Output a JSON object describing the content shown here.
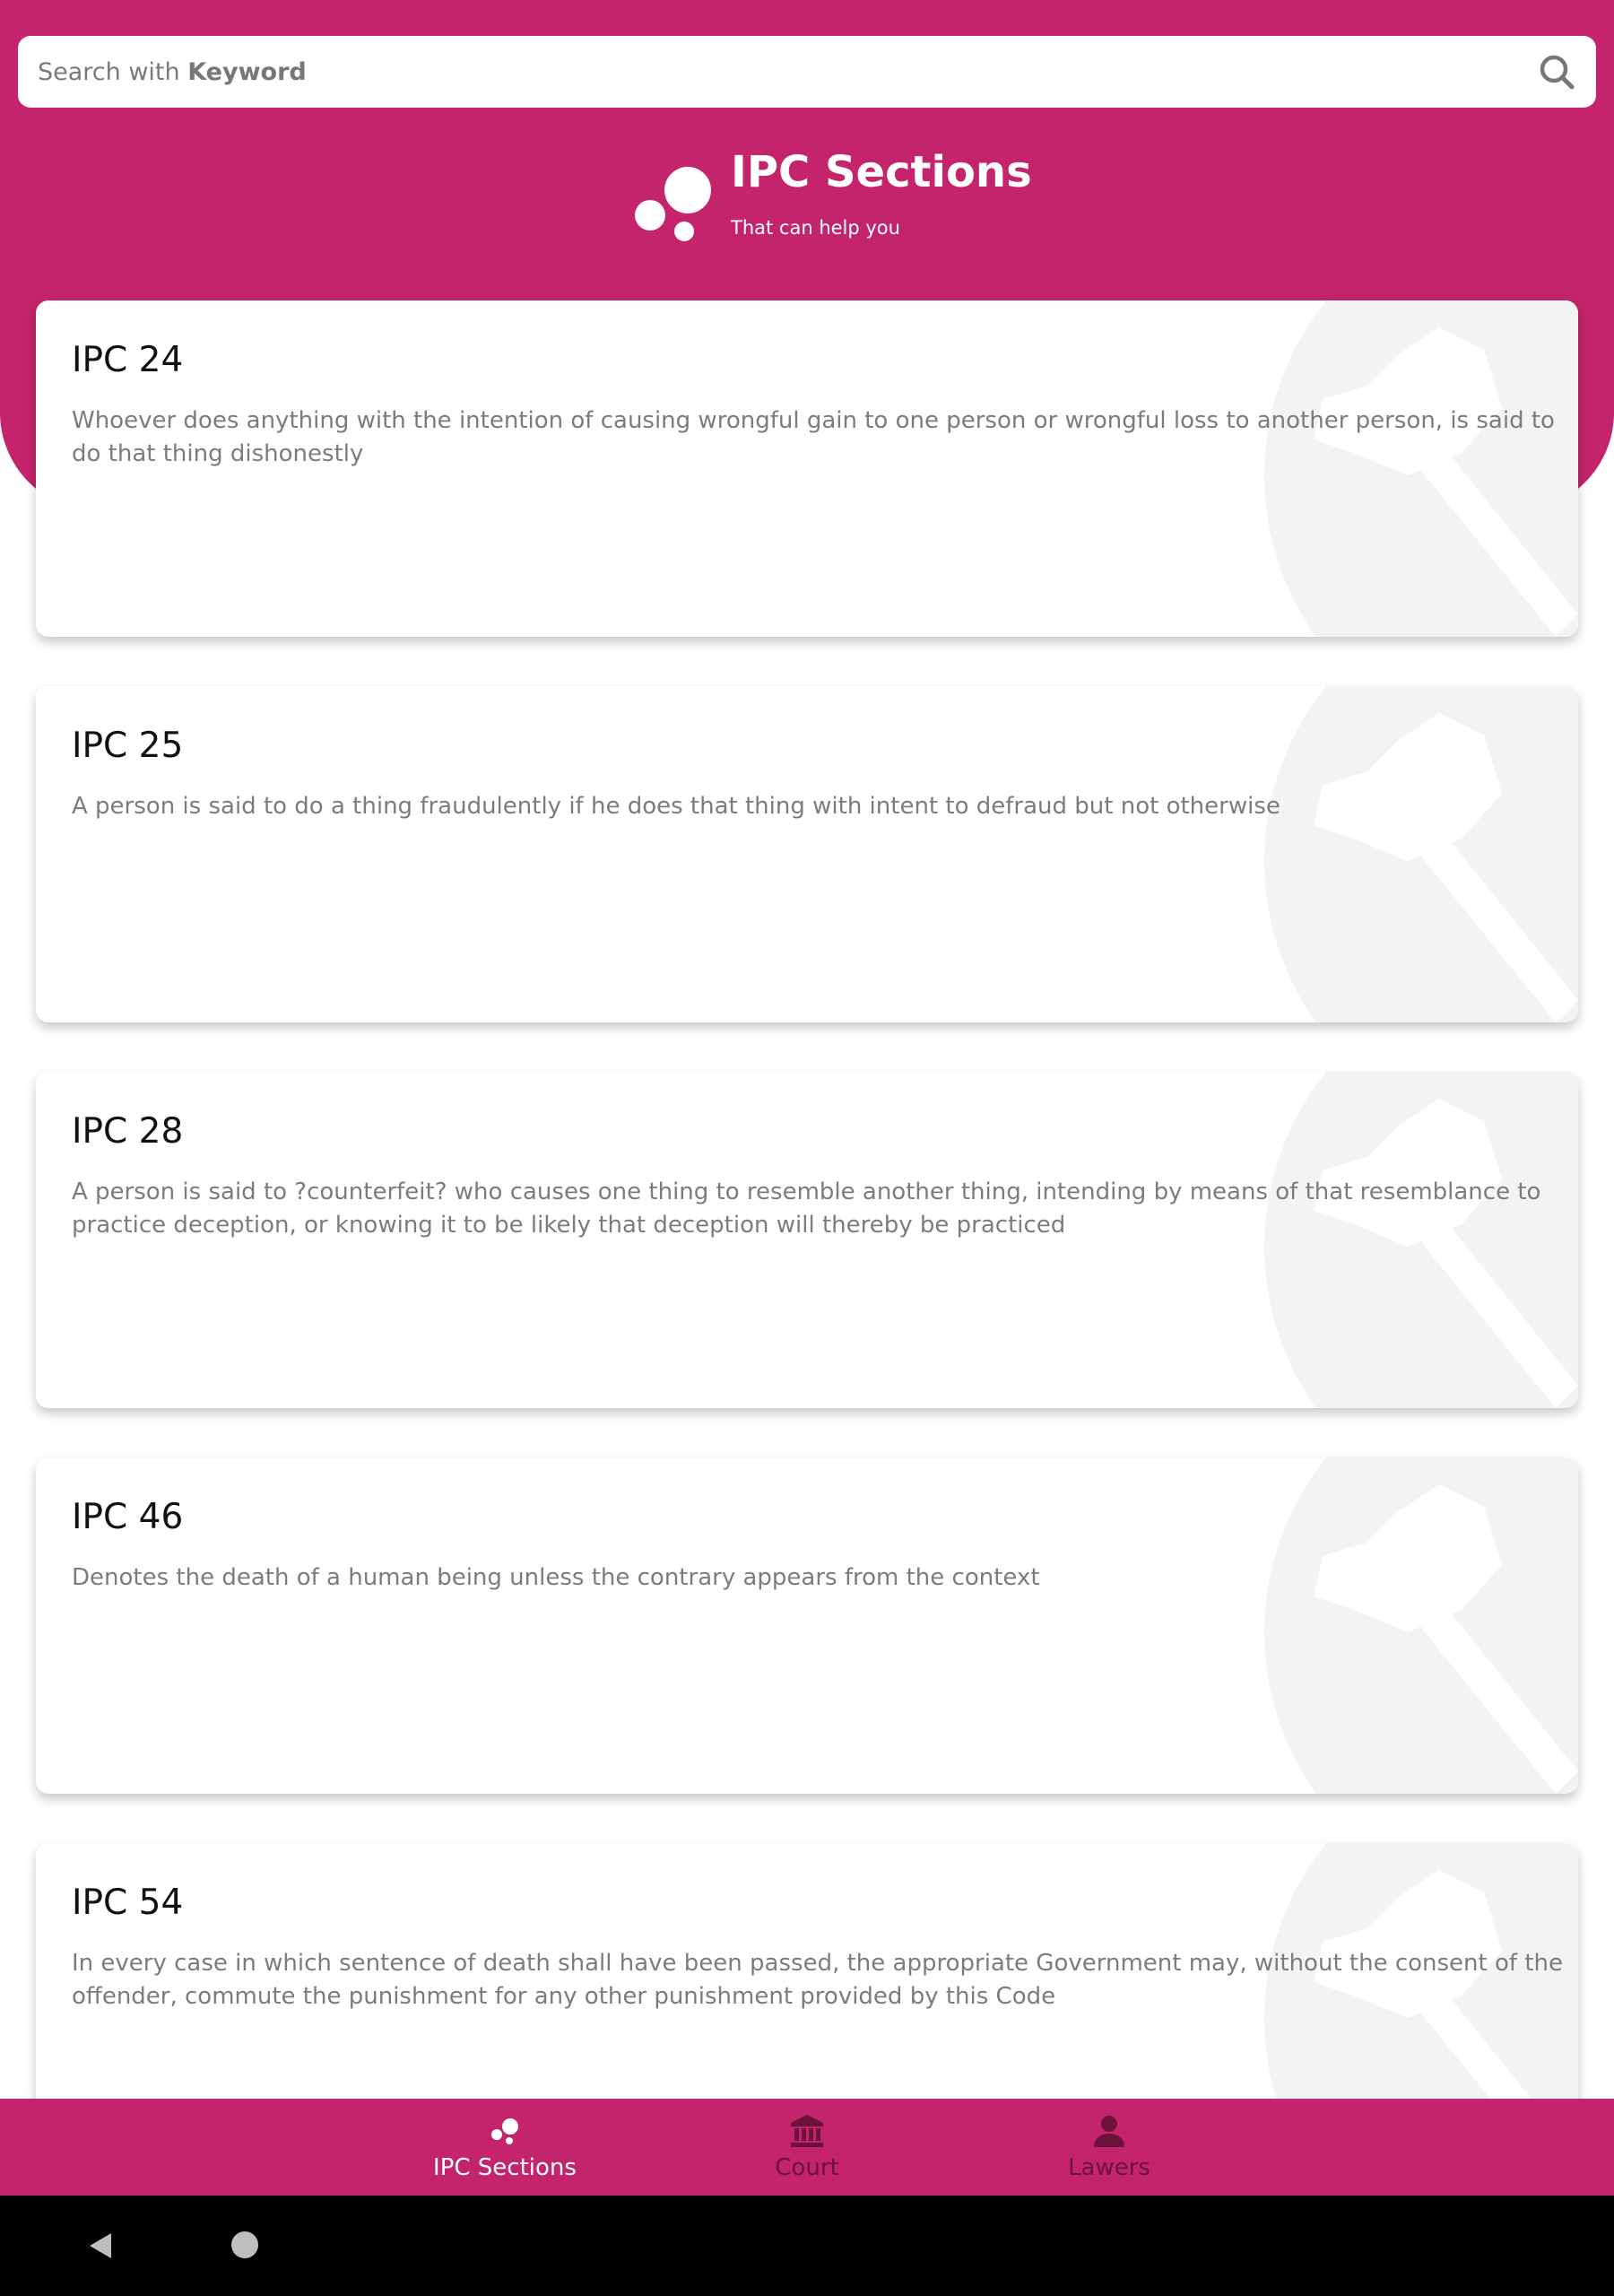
{
  "search": {
    "placeholder_prefix": "Search with ",
    "placeholder_keyword": "Keyword",
    "icon": "search-icon"
  },
  "hero": {
    "title": "IPC Sections",
    "subtitle": "That can help you",
    "logo_icon": "bubbles-logo-icon"
  },
  "sections": [
    {
      "title": "IPC 24",
      "description": "Whoever does anything with the intention of causing wrongful gain to one person or wrongful loss to another person, is said to do that thing dishonestly"
    },
    {
      "title": "IPC 25",
      "description": "A person is said to do a thing fraudulently if he does that thing with intent to defraud but not otherwise"
    },
    {
      "title": "IPC 28",
      "description": "A person is said to ?counterfeit? who causes one thing to resemble another thing, intending by means of that resemblance to practice deception, or knowing it to be likely that deception will thereby be practiced"
    },
    {
      "title": "IPC 46",
      "description": "Denotes the death of a human being unless the contrary appears from the context"
    },
    {
      "title": "IPC 54",
      "description": "In every case in which sentence of death shall have been passed, the appropriate Government may, without the consent of the offender, commute the punishment for any other punishment provided by this Code"
    }
  ],
  "bottom_nav": {
    "items": [
      {
        "label": "IPC Sections",
        "icon": "bubbles-icon",
        "active": true
      },
      {
        "label": "Court",
        "icon": "court-building-icon",
        "active": false
      },
      {
        "label": "Lawers",
        "icon": "person-icon",
        "active": false
      }
    ]
  },
  "colors": {
    "accent": "#c3246b",
    "nav_inactive": "#6b1339",
    "watermark": "#f3f3f3"
  }
}
